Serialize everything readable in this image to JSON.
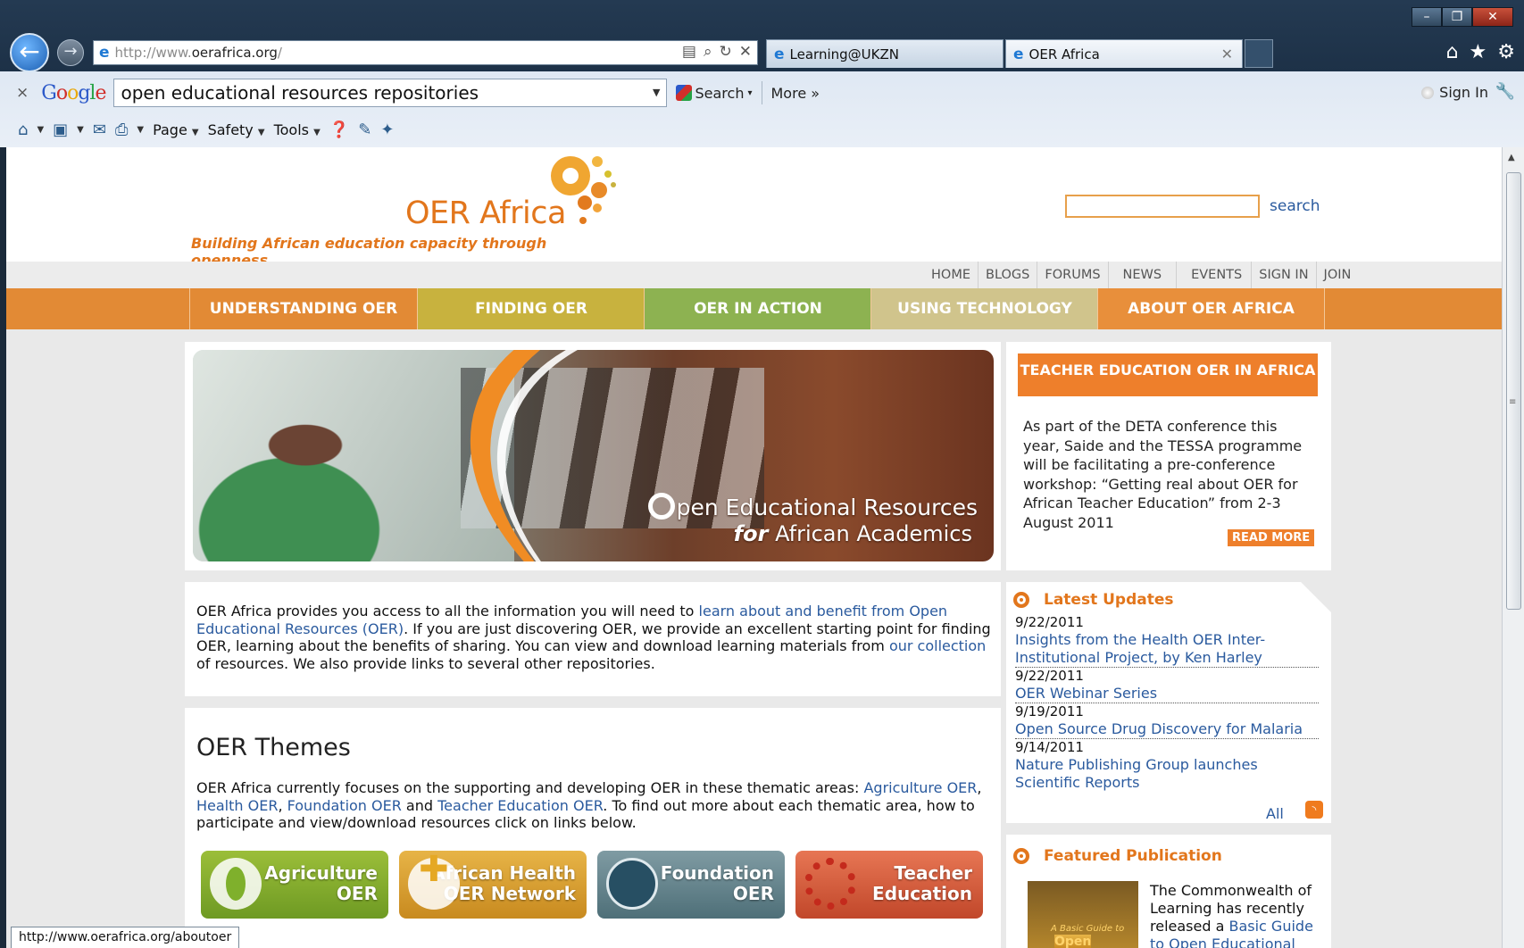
{
  "browser": {
    "url_prefix": "http://www.",
    "url_host": "oerafrica.org",
    "url_suffix": "/",
    "tabs": [
      {
        "label": "Learning@UKZN"
      },
      {
        "label": "OER Africa"
      }
    ],
    "window_controls": [
      "–",
      "❐",
      "✕"
    ]
  },
  "google_toolbar": {
    "close": "×",
    "logo": [
      "G",
      "o",
      "o",
      "g",
      "l",
      "e"
    ],
    "query": "open educational resources repositories",
    "search_label": "Search",
    "more_label": "More »",
    "signin_label": "Sign In"
  },
  "command_bar": {
    "page_label": "Page",
    "safety_label": "Safety",
    "tools_label": "Tools"
  },
  "site": {
    "logo_text": "OER Africa",
    "tagline": "Building African education capacity through openness",
    "search_link": "search",
    "utility_nav": [
      "HOME",
      "BLOGS",
      "FORUMS",
      "NEWS",
      "EVENTS",
      "SIGN IN",
      "JOIN"
    ],
    "main_nav": [
      "UNDERSTANDING OER",
      "FINDING OER",
      "OER IN ACTION",
      "USING TECHNOLOGY",
      "ABOUT OER AFRICA"
    ],
    "hero": {
      "title_rest": "pen Educational Resources",
      "subtitle_for": "for",
      "subtitle_rest": "African Academics"
    },
    "teacher": {
      "heading": "TEACHER EDUCATION OER IN AFRICA",
      "text": "As part of the DETA conference this year, Saide and the TESSA programme will be facilitating a pre-conference workshop: “Getting real about OER for African Teacher Education” from 2-3 August 2011",
      "read_more": "READ MORE"
    },
    "intro": {
      "part1": "OER Africa provides you access to all the information you will need to ",
      "link1": "learn about and benefit from Open Educational Resources (OER)",
      "part2": ". If you are just discovering OER, we provide an excellent starting point for finding OER, learning about the benefits of sharing. You can view and download learning materials from ",
      "link2": "our collection",
      "part3": " of resources.  We also provide links to several other repositories."
    },
    "updates": {
      "heading": "Latest Updates",
      "items": [
        {
          "date": "9/22/2011",
          "title": "Insights from the Health OER Inter-Institutional Project, by Ken Harley"
        },
        {
          "date": "9/22/2011",
          "title": "OER Webinar Series"
        },
        {
          "date": "9/19/2011",
          "title": "Open Source Drug Discovery for Malaria"
        },
        {
          "date": "9/14/2011",
          "title": "Nature Publishing Group launches Scientific Reports"
        }
      ],
      "all_label": "All"
    },
    "themes": {
      "title": "OER Themes",
      "p1": "OER Africa currently focuses on the supporting and developing OER in these thematic areas: ",
      "l1": "Agriculture OER",
      "c1": ", ",
      "l2": "Health OER",
      "c2": ", ",
      "l3": "Foundation OER",
      "c3": " and ",
      "l4": "Teacher Education OER",
      "p2": ". To find out more about each thematic area, how to participate and view/download resources click on links below.",
      "buttons": [
        {
          "line1": "Agriculture",
          "line2": "OER"
        },
        {
          "line1": "African Health",
          "line2": "OER Network"
        },
        {
          "line1": "Foundation",
          "line2": "OER"
        },
        {
          "line1": "Teacher",
          "line2": "Education"
        }
      ]
    },
    "featured": {
      "heading": "Featured Publication",
      "cover_line1": "A Basic Guide to",
      "cover_line2": "Open",
      "text_pre": "The Commonwealth of Learning has recently released a ",
      "text_link": "Basic Guide to Open Educational"
    }
  },
  "status_bar": {
    "hover_url": "http://www.oerafrica.org/aboutoer"
  }
}
